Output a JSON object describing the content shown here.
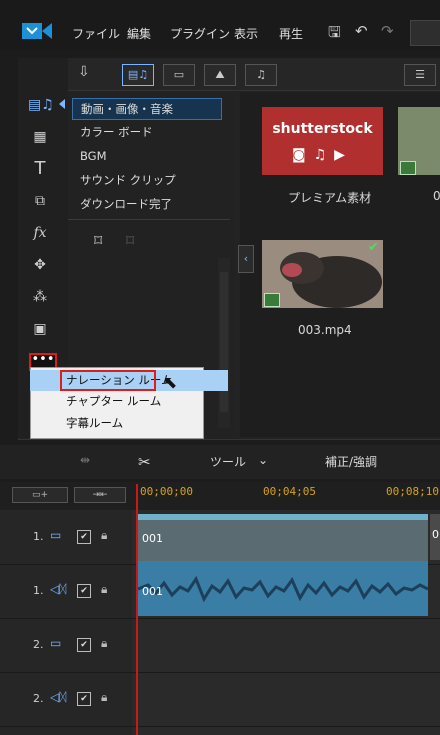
{
  "menubar": {
    "items": [
      "ファイル",
      "編集",
      "プラグイン",
      "表示",
      "再生"
    ]
  },
  "library": {
    "categories": [
      "動画・画像・音楽",
      "カラー ボード",
      "BGM",
      "サウンド クリップ",
      "ダウンロード完了"
    ],
    "selected_category": "動画・画像・音楽",
    "media": [
      {
        "label": "プレミアム素材",
        "brand": "shutterstock"
      },
      {
        "label": "003.mp4"
      }
    ],
    "more_button": "•••"
  },
  "popup_menu": {
    "items": [
      "ナレーション ルーム",
      "チャプター ルーム",
      "字幕ルーム"
    ],
    "selected": "ナレーション ルーム"
  },
  "edit_toolbar": {
    "tools_label": "ツール",
    "fix_label": "補正/強調"
  },
  "timeline": {
    "timecodes": [
      "00;00;00",
      "00;04;05",
      "00;08;10"
    ],
    "clip_label_video": "001",
    "clip_label_audio": "001",
    "clip_label_next": "0",
    "tracks": [
      {
        "number": "1.",
        "type": "video"
      },
      {
        "number": "1.",
        "type": "audio"
      },
      {
        "number": "2.",
        "type": "video"
      },
      {
        "number": "2.",
        "type": "audio"
      }
    ]
  },
  "colors": {
    "highlight_red": "#e01b1b",
    "playhead": "#c81a1a",
    "timecode": "#d6a21b",
    "selection_blue": "#a9d1f5"
  }
}
